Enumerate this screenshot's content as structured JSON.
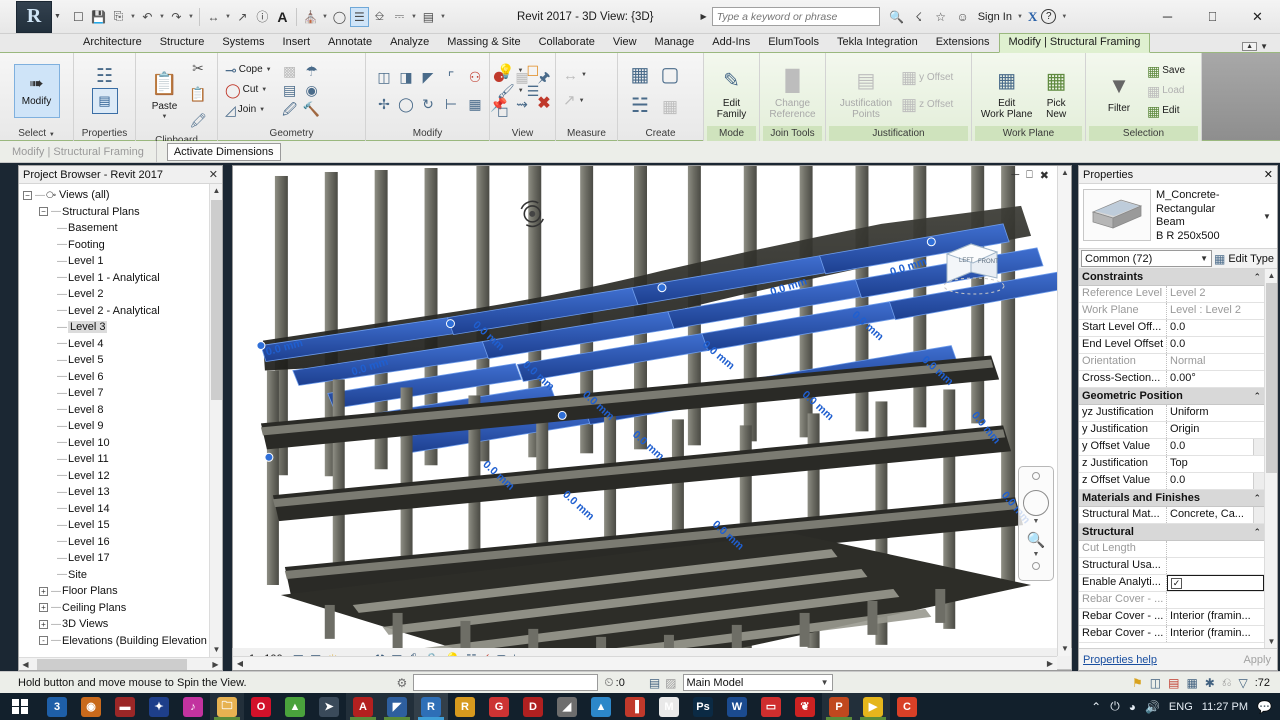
{
  "titlebar": {
    "app_button": "R",
    "title": "Revit 2017 - 3D View: {3D}",
    "search_placeholder": "Type a keyword or phrase",
    "signin": "Sign In",
    "x_badge": "X",
    "help": "?",
    "quick_access": [
      {
        "name": "open-icon",
        "glyph": "▷"
      },
      {
        "name": "save-icon",
        "glyph": "💾"
      },
      {
        "name": "save-as-icon",
        "glyph": "⎙"
      },
      {
        "name": "undo-icon",
        "glyph": "↶"
      },
      {
        "name": "redo-icon",
        "glyph": "↷"
      },
      {
        "name": "measure-icon",
        "glyph": "↔"
      },
      {
        "name": "aligned-dimension-icon",
        "glyph": "↗"
      },
      {
        "name": "tag-icon",
        "glyph": "ⓘ"
      },
      {
        "name": "text-icon",
        "glyph": "A"
      },
      {
        "name": "default-3d-view-icon",
        "glyph": "⌂"
      },
      {
        "name": "section-icon",
        "glyph": "○"
      },
      {
        "name": "thin-lines-icon",
        "glyph": "☰"
      },
      {
        "name": "close-hidden-windows-icon",
        "glyph": "❐"
      },
      {
        "name": "switch-windows-icon",
        "glyph": "❑"
      },
      {
        "name": "customize-qat-icon",
        "glyph": "▤"
      }
    ],
    "window_controls": [
      {
        "name": "minimize-button",
        "glyph": "─"
      },
      {
        "name": "maximize-button",
        "glyph": "❐"
      },
      {
        "name": "close-button",
        "glyph": "✕"
      }
    ]
  },
  "tabs": [
    {
      "label": "Architecture",
      "active": false
    },
    {
      "label": "Structure",
      "active": false
    },
    {
      "label": "Systems",
      "active": false
    },
    {
      "label": "Insert",
      "active": false
    },
    {
      "label": "Annotate",
      "active": false
    },
    {
      "label": "Analyze",
      "active": false
    },
    {
      "label": "Massing & Site",
      "active": false
    },
    {
      "label": "Collaborate",
      "active": false
    },
    {
      "label": "View",
      "active": false
    },
    {
      "label": "Manage",
      "active": false
    },
    {
      "label": "Add-Ins",
      "active": false
    },
    {
      "label": "ElumTools",
      "active": false
    },
    {
      "label": "Tekla Integration",
      "active": false
    },
    {
      "label": "Extensions",
      "active": false
    },
    {
      "label": "Modify | Structural Framing",
      "active": true
    }
  ],
  "ribbon": {
    "panels": {
      "select": {
        "title": "Select",
        "modify_label": "Modify",
        "dropdown_caret": "▾"
      },
      "properties": {
        "title": "Properties"
      },
      "clipboard": {
        "title": "Clipboard",
        "paste_label": "Paste"
      },
      "geometry": {
        "title": "Geometry",
        "items": [
          {
            "label": "Cope",
            "has_caret": true
          },
          {
            "label": "Cut",
            "has_caret": true
          },
          {
            "label": "Join",
            "has_caret": true
          }
        ]
      },
      "modify": {
        "title": "Modify"
      },
      "view": {
        "title": "View"
      },
      "measure": {
        "title": "Measure"
      },
      "create": {
        "title": "Create"
      },
      "mode": {
        "title": "Mode",
        "edit_family": "Edit\nFamily",
        "edit_family_l1": "Edit",
        "edit_family_l2": "Family"
      },
      "join_tools": {
        "title": "Join Tools",
        "change_ref_l1": "Change",
        "change_ref_l2": "Reference"
      },
      "justification": {
        "title": "Justification",
        "points_l1": "Justification",
        "points_l2": "Points",
        "y_offset": "y Offset",
        "z_offset": "z Offset"
      },
      "work_plane": {
        "title": "Work Plane",
        "edit_wp_l1": "Edit",
        "edit_wp_l2": "Work Plane",
        "pick_new_l1": "Pick",
        "pick_new_l2": "New"
      },
      "selection": {
        "title": "Selection",
        "filter": "Filter",
        "save": "Save",
        "load": "Load",
        "edit": "Edit"
      }
    }
  },
  "options_bar": {
    "context_label": "Modify | Structural Framing",
    "activate_dimensions": "Activate Dimensions"
  },
  "project_browser": {
    "title": "Project Browser - Revit 2017",
    "close": "✕",
    "root": "Views (all)",
    "group": "Structural Plans",
    "items": [
      {
        "label": "Basement",
        "selected": false
      },
      {
        "label": "Footing",
        "selected": false
      },
      {
        "label": "Level 1",
        "selected": false
      },
      {
        "label": "Level 1 - Analytical",
        "selected": false
      },
      {
        "label": "Level 2",
        "selected": false
      },
      {
        "label": "Level 2 - Analytical",
        "selected": false
      },
      {
        "label": "Level 3",
        "selected": true
      },
      {
        "label": "Level 4",
        "selected": false
      },
      {
        "label": "Level 5",
        "selected": false
      },
      {
        "label": "Level 6",
        "selected": false
      },
      {
        "label": "Level 7",
        "selected": false
      },
      {
        "label": "Level 8",
        "selected": false
      },
      {
        "label": "Level 9",
        "selected": false
      },
      {
        "label": "Level 10",
        "selected": false
      },
      {
        "label": "Level 11",
        "selected": false
      },
      {
        "label": "Level 12",
        "selected": false
      },
      {
        "label": "Level 13",
        "selected": false
      },
      {
        "label": "Level 14",
        "selected": false
      },
      {
        "label": "Level 15",
        "selected": false
      },
      {
        "label": "Level 16",
        "selected": false
      },
      {
        "label": "Level 17",
        "selected": false
      },
      {
        "label": "Site",
        "selected": false
      }
    ],
    "collapsed_groups": [
      {
        "label": "Floor Plans",
        "expander": "+"
      },
      {
        "label": "Ceiling Plans",
        "expander": "+"
      },
      {
        "label": "3D Views",
        "expander": "+"
      },
      {
        "label": "Elevations (Building Elevation",
        "expander": "-"
      }
    ]
  },
  "properties": {
    "title": "Properties",
    "close": "✕",
    "type_line1": "M_Concrete-Rectangular",
    "type_line2": "Beam",
    "type_line3": "B R 250x500",
    "selector": "Common (72)",
    "edit_type": "Edit Type",
    "help_link": "Properties help",
    "apply": "Apply",
    "groups": [
      {
        "name": "Constraints",
        "rows": [
          {
            "key": "Reference Level",
            "value": "Level 2",
            "key_dim": true,
            "val_dim": true
          },
          {
            "key": "Work Plane",
            "value": "Level : Level 2",
            "key_dim": true,
            "val_dim": true
          },
          {
            "key": "Start Level Off...",
            "value": "0.0",
            "key_dim": false,
            "val_dim": false
          },
          {
            "key": "End Level Offset",
            "value": "0.0",
            "key_dim": false,
            "val_dim": false
          },
          {
            "key": "Orientation",
            "value": "Normal",
            "key_dim": true,
            "val_dim": true
          },
          {
            "key": "Cross-Section...",
            "value": "0.00°",
            "key_dim": false,
            "val_dim": false
          }
        ]
      },
      {
        "name": "Geometric Position",
        "rows": [
          {
            "key": "yz Justification",
            "value": "Uniform",
            "key_dim": false,
            "val_dim": false
          },
          {
            "key": "y Justification",
            "value": "Origin",
            "key_dim": false,
            "val_dim": false
          },
          {
            "key": "y Offset Value",
            "value": "0.0",
            "key_dim": false,
            "val_dim": false,
            "has_button": true
          },
          {
            "key": "z Justification",
            "value": "Top",
            "key_dim": false,
            "val_dim": false
          },
          {
            "key": "z Offset Value",
            "value": "0.0",
            "key_dim": false,
            "val_dim": false,
            "has_button": true
          }
        ]
      },
      {
        "name": "Materials and Finishes",
        "rows": [
          {
            "key": "Structural Mat...",
            "value": "Concrete, Ca...",
            "key_dim": false,
            "val_dim": false,
            "has_button": true
          }
        ]
      },
      {
        "name": "Structural",
        "rows": [
          {
            "key": "Cut Length",
            "value": "",
            "key_dim": true,
            "val_dim": true
          },
          {
            "key": "Structural Usa...",
            "value": "",
            "key_dim": false,
            "val_dim": false
          },
          {
            "key": "Enable Analyti...",
            "value": "",
            "key_dim": false,
            "val_dim": false,
            "checkbox": true,
            "checked": true
          },
          {
            "key": "Rebar Cover - ...",
            "value": "",
            "key_dim": true,
            "val_dim": true
          },
          {
            "key": "Rebar Cover - ...",
            "value": "Interior (framin...",
            "key_dim": false,
            "val_dim": false
          },
          {
            "key": "Rebar Cover - ...",
            "value": "Interior (framin...",
            "key_dim": false,
            "val_dim": false
          }
        ]
      }
    ]
  },
  "viewport": {
    "scale": "1 : 100",
    "dimension_label": "0.0 mm",
    "viewcube_faces": {
      "left": "LEFT",
      "front": "FRONT"
    },
    "window_controls": [
      {
        "name": "view-minimize-icon",
        "glyph": "─"
      },
      {
        "name": "view-restore-icon",
        "glyph": "❐"
      },
      {
        "name": "view-close-icon",
        "glyph": "✖"
      }
    ],
    "control_icons": [
      {
        "name": "scale-icon",
        "glyph": "▒"
      },
      {
        "name": "detail-level-icon",
        "glyph": "❑"
      },
      {
        "name": "visual-style-icon",
        "glyph": "☀"
      },
      {
        "name": "sun-path-icon",
        "glyph": "☀"
      },
      {
        "name": "shadows-icon",
        "glyph": "◑"
      },
      {
        "name": "rendering-dialog-icon",
        "glyph": "⚒"
      },
      {
        "name": "crop-view-icon",
        "glyph": "⌧"
      },
      {
        "name": "show-crop-region-icon",
        "glyph": "⬚"
      },
      {
        "name": "lock-3d-view-icon",
        "glyph": "⚿"
      },
      {
        "name": "temporary-hide-isolate-icon",
        "glyph": "◎"
      },
      {
        "name": "reveal-hidden-elements-icon",
        "glyph": "⚫"
      },
      {
        "name": "temporary-view-properties-icon",
        "glyph": "▧"
      },
      {
        "name": "analytical-model-icon",
        "glyph": "▱"
      },
      {
        "name": "constraints-icon",
        "glyph": "⊢"
      },
      {
        "name": "expand-icon",
        "glyph": "‹"
      }
    ]
  },
  "status_bar": {
    "message": "Hold button and move mouse to Spin the View.",
    "worksets_label": "",
    "design_option": "Main Model",
    "filter_count": ":72",
    "progress_count": ":0",
    "right_icons": [
      {
        "name": "exclude-options-icon",
        "glyph": "⚑"
      },
      {
        "name": "editable-only-icon",
        "glyph": "◰"
      },
      {
        "name": "active-workset-icon",
        "glyph": "▣"
      },
      {
        "name": "press-drag-icon",
        "glyph": "❐"
      },
      {
        "name": "select-links-icon",
        "glyph": "✱"
      },
      {
        "name": "select-pinned-icon",
        "glyph": "◌"
      },
      {
        "name": "filter-icon",
        "glyph": "▽"
      }
    ]
  },
  "taskbar": {
    "items": [
      {
        "name": "taskbar-explorer",
        "glyph": "3",
        "color": "#1e5fa8",
        "state": ""
      },
      {
        "name": "taskbar-app-2",
        "glyph": "◉",
        "color": "#c96a1c",
        "state": ""
      },
      {
        "name": "taskbar-app-3",
        "glyph": "▬",
        "color": "#9b2727",
        "state": ""
      },
      {
        "name": "taskbar-app-4",
        "glyph": "✦",
        "color": "#1e3f8a",
        "state": ""
      },
      {
        "name": "taskbar-itunes",
        "glyph": "♪",
        "color": "#c2339f",
        "state": ""
      },
      {
        "name": "taskbar-file-explorer",
        "glyph": "🗀",
        "color": "#e7b251",
        "state": "open"
      },
      {
        "name": "taskbar-opera",
        "glyph": "O",
        "color": "#d2112a",
        "state": ""
      },
      {
        "name": "taskbar-app-8",
        "glyph": "▲",
        "color": "#4aa23c",
        "state": ""
      },
      {
        "name": "taskbar-app-9",
        "glyph": "➤",
        "color": "#3a4a5a",
        "state": ""
      },
      {
        "name": "taskbar-autocad",
        "glyph": "A",
        "color": "#b3201f",
        "state": "open"
      },
      {
        "name": "taskbar-app-11",
        "glyph": "◤",
        "color": "#2e5f9e",
        "state": "open"
      },
      {
        "name": "taskbar-revit-active",
        "glyph": "R",
        "color": "#2e6fb7",
        "state": "active"
      },
      {
        "name": "taskbar-revit-2",
        "glyph": "R",
        "color": "#d79a1e",
        "state": ""
      },
      {
        "name": "taskbar-app-13",
        "glyph": "G",
        "color": "#c33",
        "state": ""
      },
      {
        "name": "taskbar-app-14",
        "glyph": "D",
        "color": "#b02020",
        "state": ""
      },
      {
        "name": "taskbar-app-15",
        "glyph": "◢",
        "color": "#6d6d6d",
        "state": ""
      },
      {
        "name": "taskbar-app-16",
        "glyph": "▲",
        "color": "#2c87c9",
        "state": ""
      },
      {
        "name": "taskbar-app-17",
        "glyph": "▐",
        "color": "#c0392b",
        "state": ""
      },
      {
        "name": "taskbar-app-18",
        "glyph": "M",
        "color": "#e9e9e9",
        "state": ""
      },
      {
        "name": "taskbar-photoshop",
        "glyph": "Ps",
        "color": "#0b2a44",
        "state": ""
      },
      {
        "name": "taskbar-word",
        "glyph": "W",
        "color": "#1b4b8f",
        "state": ""
      },
      {
        "name": "taskbar-app-20",
        "glyph": "▭",
        "color": "#cf2e2e",
        "state": ""
      },
      {
        "name": "taskbar-app-21",
        "glyph": "❦",
        "color": "#cc2222",
        "state": ""
      },
      {
        "name": "taskbar-powerpoint",
        "glyph": "P",
        "color": "#c0481e",
        "state": "open"
      },
      {
        "name": "taskbar-media-player",
        "glyph": "▶",
        "color": "#e5b61c",
        "state": "open"
      },
      {
        "name": "taskbar-app-24",
        "glyph": "C",
        "color": "#d84027",
        "state": ""
      }
    ],
    "tray": {
      "chevron": "⌃",
      "battery": "🔋",
      "wifi": "📶",
      "volume": "🔊",
      "language": "ENG",
      "time": "11:27 PM",
      "action_center": "▭"
    }
  }
}
